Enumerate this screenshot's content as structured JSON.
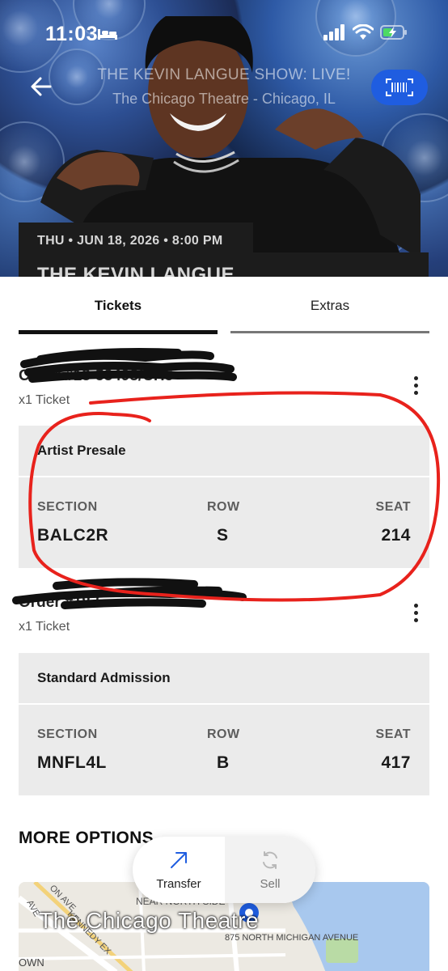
{
  "status_bar": {
    "time": "11:03"
  },
  "hero": {
    "title": "THE KEVIN LANGUE SHOW: LIVE!",
    "venue_line": "The Chicago Theatre - Chicago, IL",
    "date_line": "THU • JUN 18, 2026 • 8:00 PM",
    "event_name_partial": "THE KEVIN LANGUE"
  },
  "tabs": [
    {
      "label": "Tickets",
      "active": true
    },
    {
      "label": "Extras",
      "active": false
    }
  ],
  "orders": [
    {
      "order_number": "Order #18-53498/CH5",
      "count": "x1 Ticket",
      "ticket_type": "Artist Presale",
      "labels": {
        "section": "SECTION",
        "row": "ROW",
        "seat": "SEAT"
      },
      "section": "BALC2R",
      "row": "S",
      "seat": "214"
    },
    {
      "order_number": "Order #18-5",
      "count": "x1 Ticket",
      "ticket_type": "Standard Admission",
      "labels": {
        "section": "SECTION",
        "row": "ROW",
        "seat": "SEAT"
      },
      "section": "MNFL4L",
      "row": "B",
      "seat": "417"
    }
  ],
  "more_options": "MORE OPTIONS",
  "actions": {
    "transfer": "Transfer",
    "sell": "Sell"
  },
  "map": {
    "venue_label": "The Chicago Theatre",
    "labels": [
      "NEAR NORTH SIDE",
      "875 NORTH MICHIGAN AVENUE",
      "KENNEDY EX",
      "ON AVE",
      "AVE",
      "OWN"
    ]
  },
  "colors": {
    "accent_blue": "#1f5de0",
    "annotation_red": "#e8221c",
    "card_gray": "#ebebeb"
  }
}
